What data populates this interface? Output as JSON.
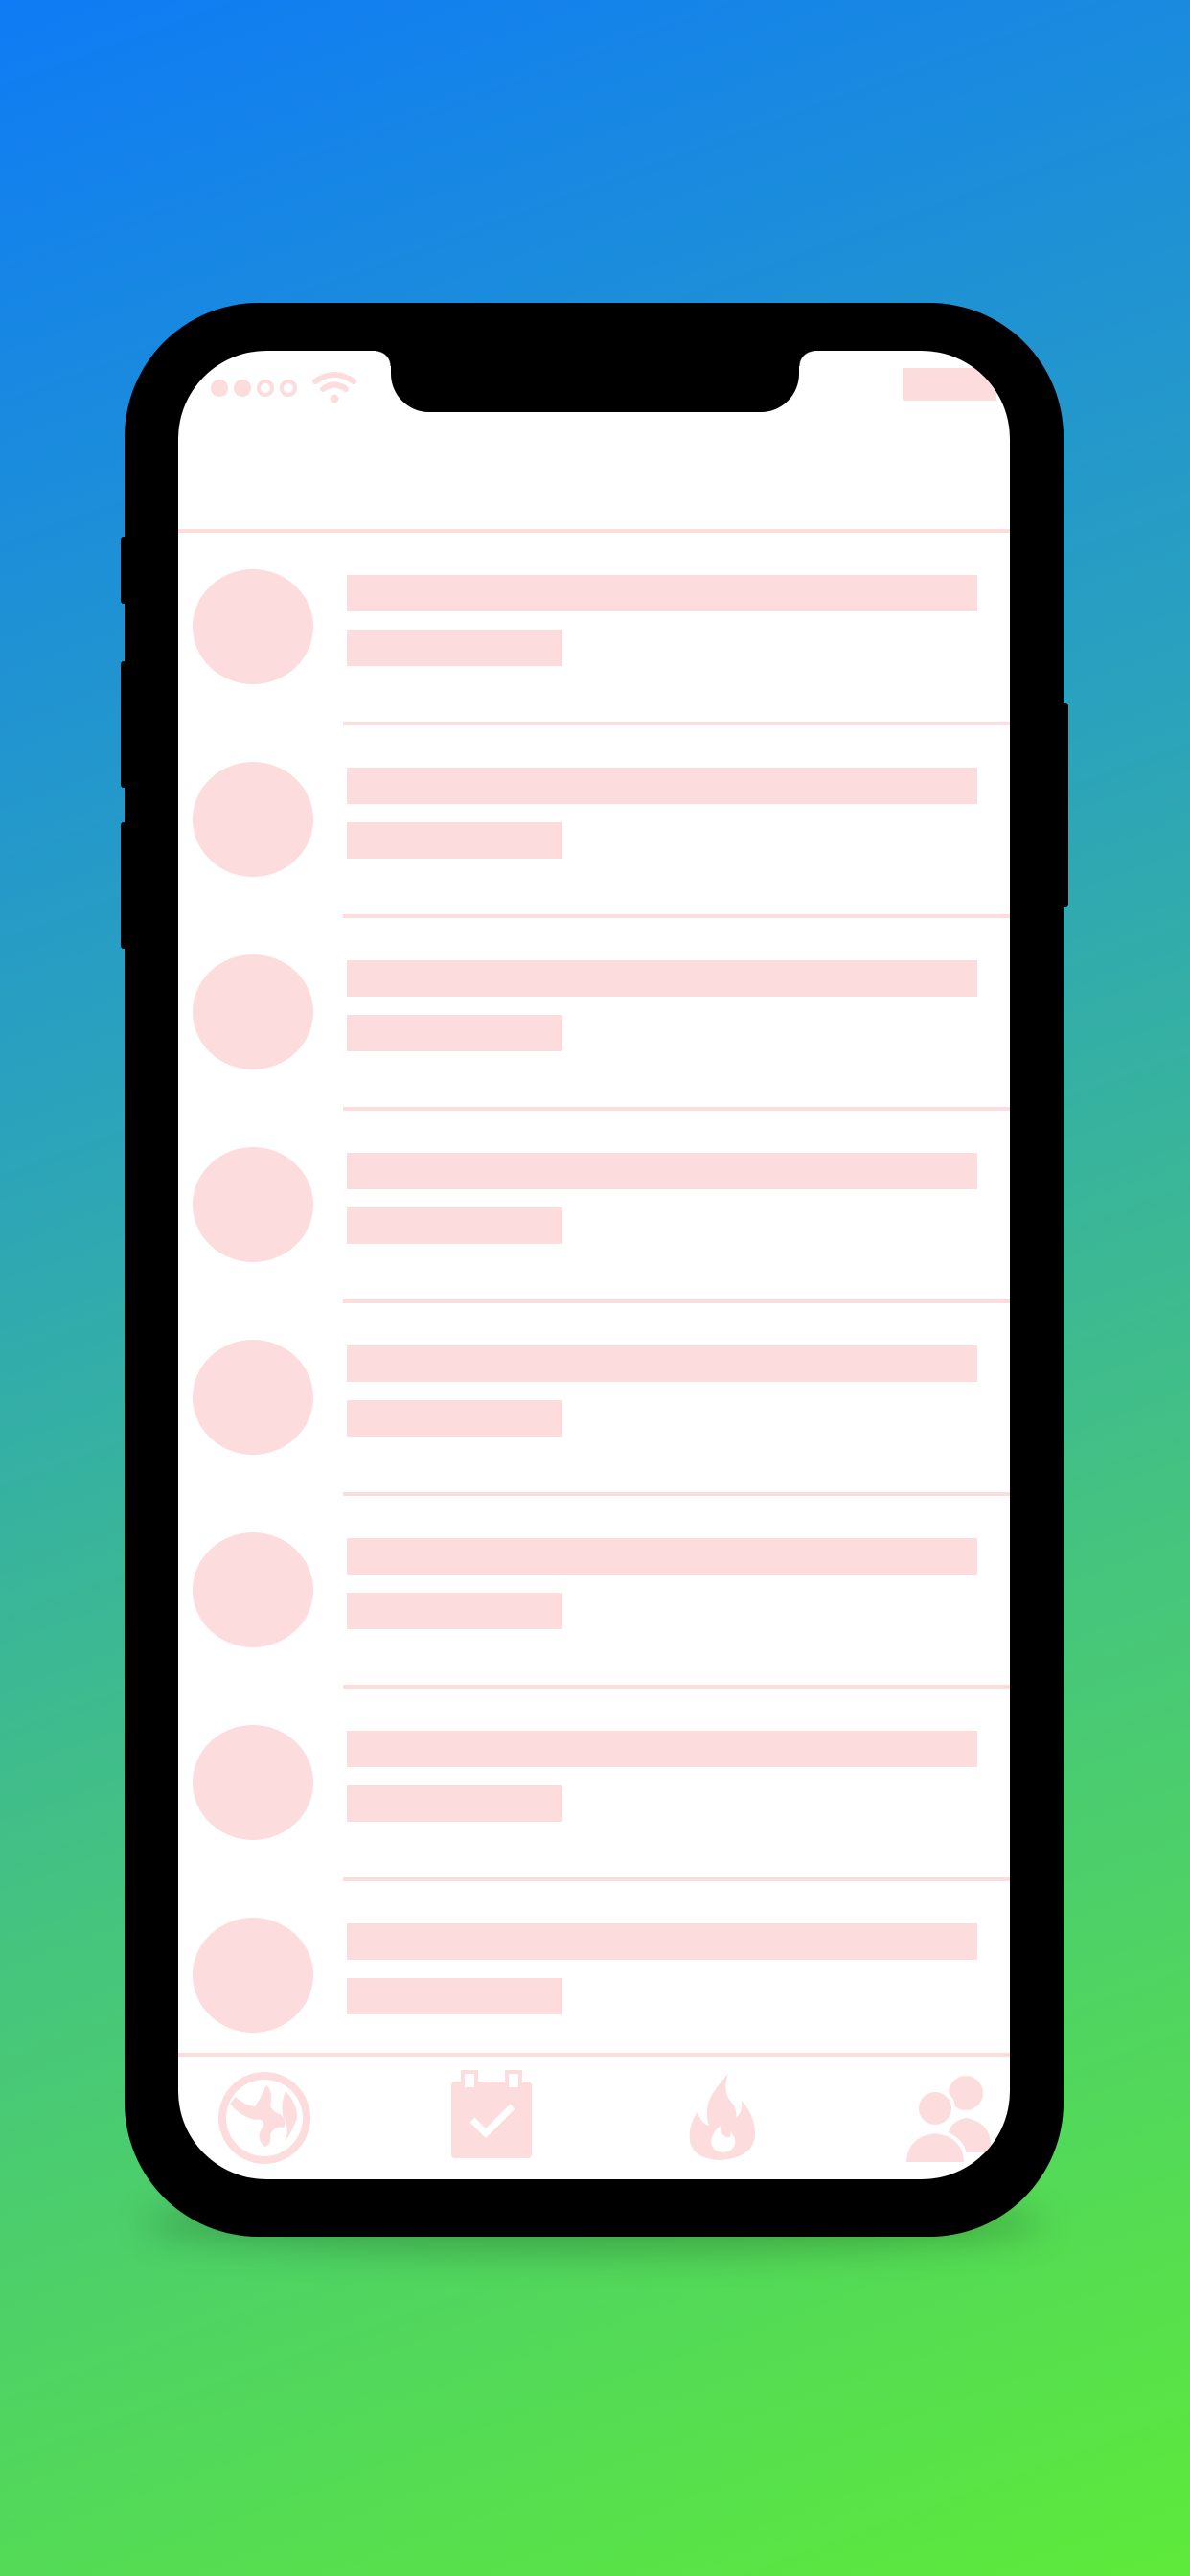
{
  "app": {
    "screen": "skeleton-loading-list"
  },
  "colors": {
    "background_top": "#0f7bf5",
    "background_bottom": "#5eea3a",
    "placeholder": "#fcdcdd",
    "device": "#000000",
    "screen": "#ffffff"
  },
  "status_bar": {
    "signal_icon": "signal-dots-icon",
    "wifi_icon": "wifi-icon",
    "battery_placeholder": "battery-placeholder"
  },
  "list": {
    "rows": [
      {
        "type": "placeholder"
      },
      {
        "type": "placeholder"
      },
      {
        "type": "placeholder"
      },
      {
        "type": "placeholder"
      },
      {
        "type": "placeholder"
      },
      {
        "type": "placeholder"
      },
      {
        "type": "placeholder"
      },
      {
        "type": "placeholder"
      }
    ]
  },
  "tabbar": {
    "tabs": [
      {
        "icon": "globe-icon"
      },
      {
        "icon": "calendar-check-icon"
      },
      {
        "icon": "fire-icon"
      },
      {
        "icon": "users-icon"
      }
    ]
  }
}
